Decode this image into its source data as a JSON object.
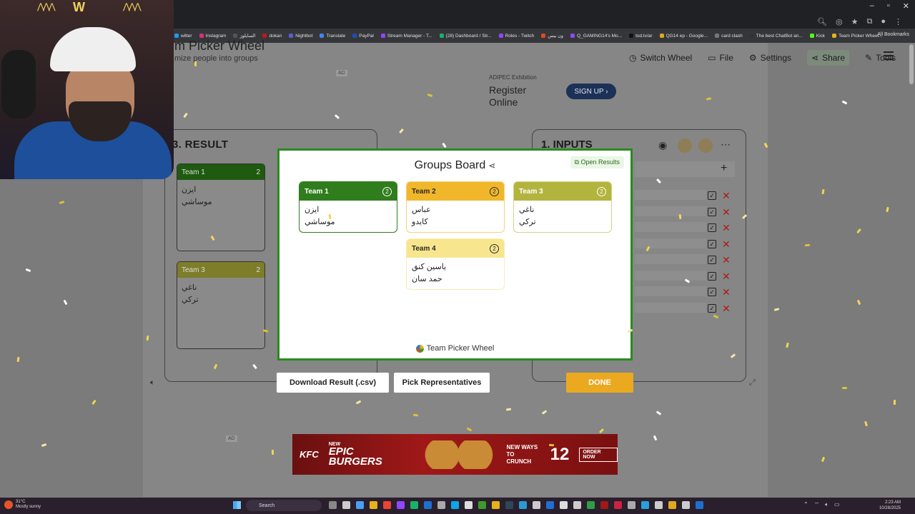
{
  "browser": {
    "window_controls": [
      "–",
      "▫",
      "✕"
    ],
    "bookmarks": [
      {
        "label": "witter",
        "color": "#1d9bf0"
      },
      {
        "label": "Instagram",
        "color": "#d6307a"
      },
      {
        "label": "السايلوز",
        "color": "#555555"
      },
      {
        "label": "dokan",
        "color": "#bd1b1b"
      },
      {
        "label": "Nightbot",
        "color": "#5b5bd6"
      },
      {
        "label": "Translate",
        "color": "#4285f4"
      },
      {
        "label": "PayPal",
        "color": "#1f4fb3"
      },
      {
        "label": "Stream Manager - T...",
        "color": "#9146ff"
      },
      {
        "label": "(28) Dashboard / Str...",
        "color": "#18b26a"
      },
      {
        "label": "Roles - Twitch",
        "color": "#9146ff"
      },
      {
        "label": "ون بيس",
        "color": "#e04a1e"
      },
      {
        "label": "Q_GAMING14's Mo...",
        "color": "#9146ff"
      },
      {
        "label": "tod.tv/ar",
        "color": "#111111"
      },
      {
        "label": "QG14 ep - Google...",
        "color": "#e0a820"
      },
      {
        "label": "card clash",
        "color": "#777777"
      },
      {
        "label": "The best ChatBot an...",
        "color": "#333333"
      },
      {
        "label": "Kick",
        "color": "#53fc18"
      },
      {
        "label": "Team Picker Wheel...",
        "color": "#e8b21c"
      }
    ],
    "all_bookmarks": "All Bookmarks"
  },
  "site": {
    "nav": {
      "switch_wheel": "Switch Wheel",
      "file": "File",
      "settings": "Settings",
      "share": "Share",
      "tools": "Tools"
    },
    "banner_title": "m Picker Wheel",
    "banner_subtitle": "mize people into groups",
    "result_title": "3. RESULT",
    "inputs_title": "1. INPUTS",
    "result_cards": [
      {
        "name": "Team 1",
        "count": "2",
        "color": "#1e5a10",
        "members": [
          "ايزن",
          "موساشي"
        ]
      },
      {
        "name": "Team 3",
        "count": "2",
        "color": "#7d7d2a",
        "members": [
          "ناغي",
          "تركي"
        ]
      }
    ]
  },
  "ads": {
    "ad_label": "AD",
    "top_small": "ADIPEC Exhibition",
    "top_large_1": "Register",
    "top_large_2": "Online",
    "signup": "SIGN UP",
    "bottom_kfc": "KFC",
    "bottom_new": "NEW",
    "bottom_epic": "EPIC BURGERS",
    "bottom_crunch_1": "NEW WAYS",
    "bottom_crunch_2": "TO CRUNCH",
    "bottom_twelve": "12",
    "bottom_order": "ORDER NOW"
  },
  "modal": {
    "title": "Groups Board",
    "open_results": "Open Results",
    "footer": "Team Picker Wheel",
    "teams": [
      {
        "name": "Team 1",
        "count": "2",
        "header_bg": "#2f7d1c",
        "header_fg": "#ffffff",
        "border": "#2f7d1c",
        "members": [
          "ايزن",
          "موساشي"
        ]
      },
      {
        "name": "Team 2",
        "count": "2",
        "header_bg": "#f0b72a",
        "header_fg": "#2a2a2a",
        "border": "#f5d27a",
        "members": [
          "عباس",
          "كايدو"
        ]
      },
      {
        "name": "Team 3",
        "count": "2",
        "header_bg": "#b3b43e",
        "header_fg": "#ffffff",
        "border": "#d4d48a",
        "members": [
          "ناغي",
          "تركي"
        ]
      },
      {
        "name": "Team 4",
        "count": "2",
        "header_bg": "#f7e68e",
        "header_fg": "#2a2a2a",
        "border": "#f7ebb8",
        "members": [
          "ياسين كنق",
          "حمد سان"
        ]
      }
    ],
    "download_button": "Download Result (.csv)",
    "pick_button": "Pick Representatives",
    "done_button": "DONE"
  },
  "taskbar": {
    "weather_temp": "31°C",
    "weather_desc": "Mostly sunny",
    "search": "Search",
    "time": "2:23 AM",
    "date": "10/28/2025"
  }
}
